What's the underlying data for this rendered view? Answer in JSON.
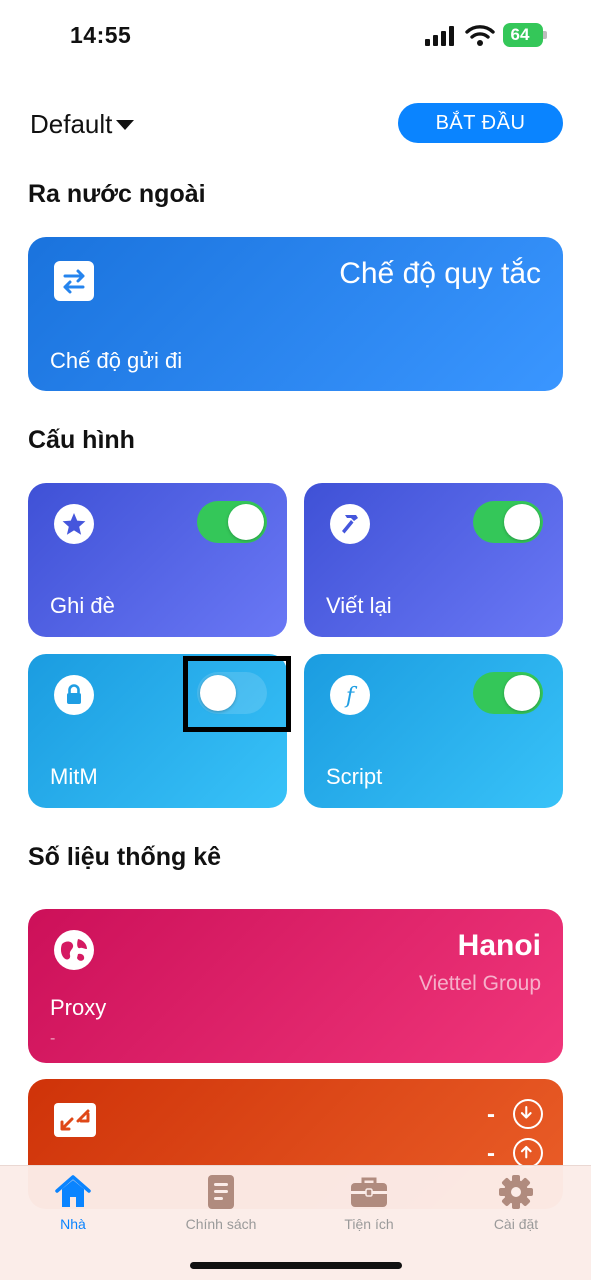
{
  "status": {
    "time": "14:55",
    "battery": "64"
  },
  "header": {
    "profile_name": "Default",
    "start_button": "BẮT ĐẦU"
  },
  "outbound": {
    "section_title": "Ra nước ngoài",
    "mode_value": "Chế độ quy tắc",
    "mode_label": "Chế độ gửi đi"
  },
  "config": {
    "section_title": "Cấu hình",
    "items": [
      {
        "label": "Ghi đè",
        "icon": "star-icon",
        "enabled": true
      },
      {
        "label": "Viết lại",
        "icon": "hammer-icon",
        "enabled": true
      },
      {
        "label": "MitM",
        "icon": "lock-icon",
        "enabled": false
      },
      {
        "label": "Script",
        "icon": "function-icon",
        "enabled": true
      }
    ]
  },
  "stats": {
    "section_title": "Số liệu thống kê",
    "proxy": {
      "label": "Proxy",
      "city": "Hanoi",
      "isp": "Viettel Group",
      "sub": "-"
    },
    "traffic": {
      "download": "-",
      "upload": "-"
    }
  },
  "tabbar": {
    "tabs": [
      {
        "label": "Nhà",
        "icon": "home-icon",
        "active": true
      },
      {
        "label": "Chính sách",
        "icon": "policy-icon",
        "active": false
      },
      {
        "label": "Tiện ích",
        "icon": "toolbox-icon",
        "active": false
      },
      {
        "label": "Cài đặt",
        "icon": "gear-icon",
        "active": false
      }
    ]
  },
  "colors": {
    "accent": "#0a84ff",
    "toggle_on": "#34c759",
    "outbound_card": "#2584ee",
    "config_purple": "#5462e6",
    "config_cyan": "#28aef0",
    "proxy_card": "#e0236a",
    "traffic_card": "#df4818"
  }
}
